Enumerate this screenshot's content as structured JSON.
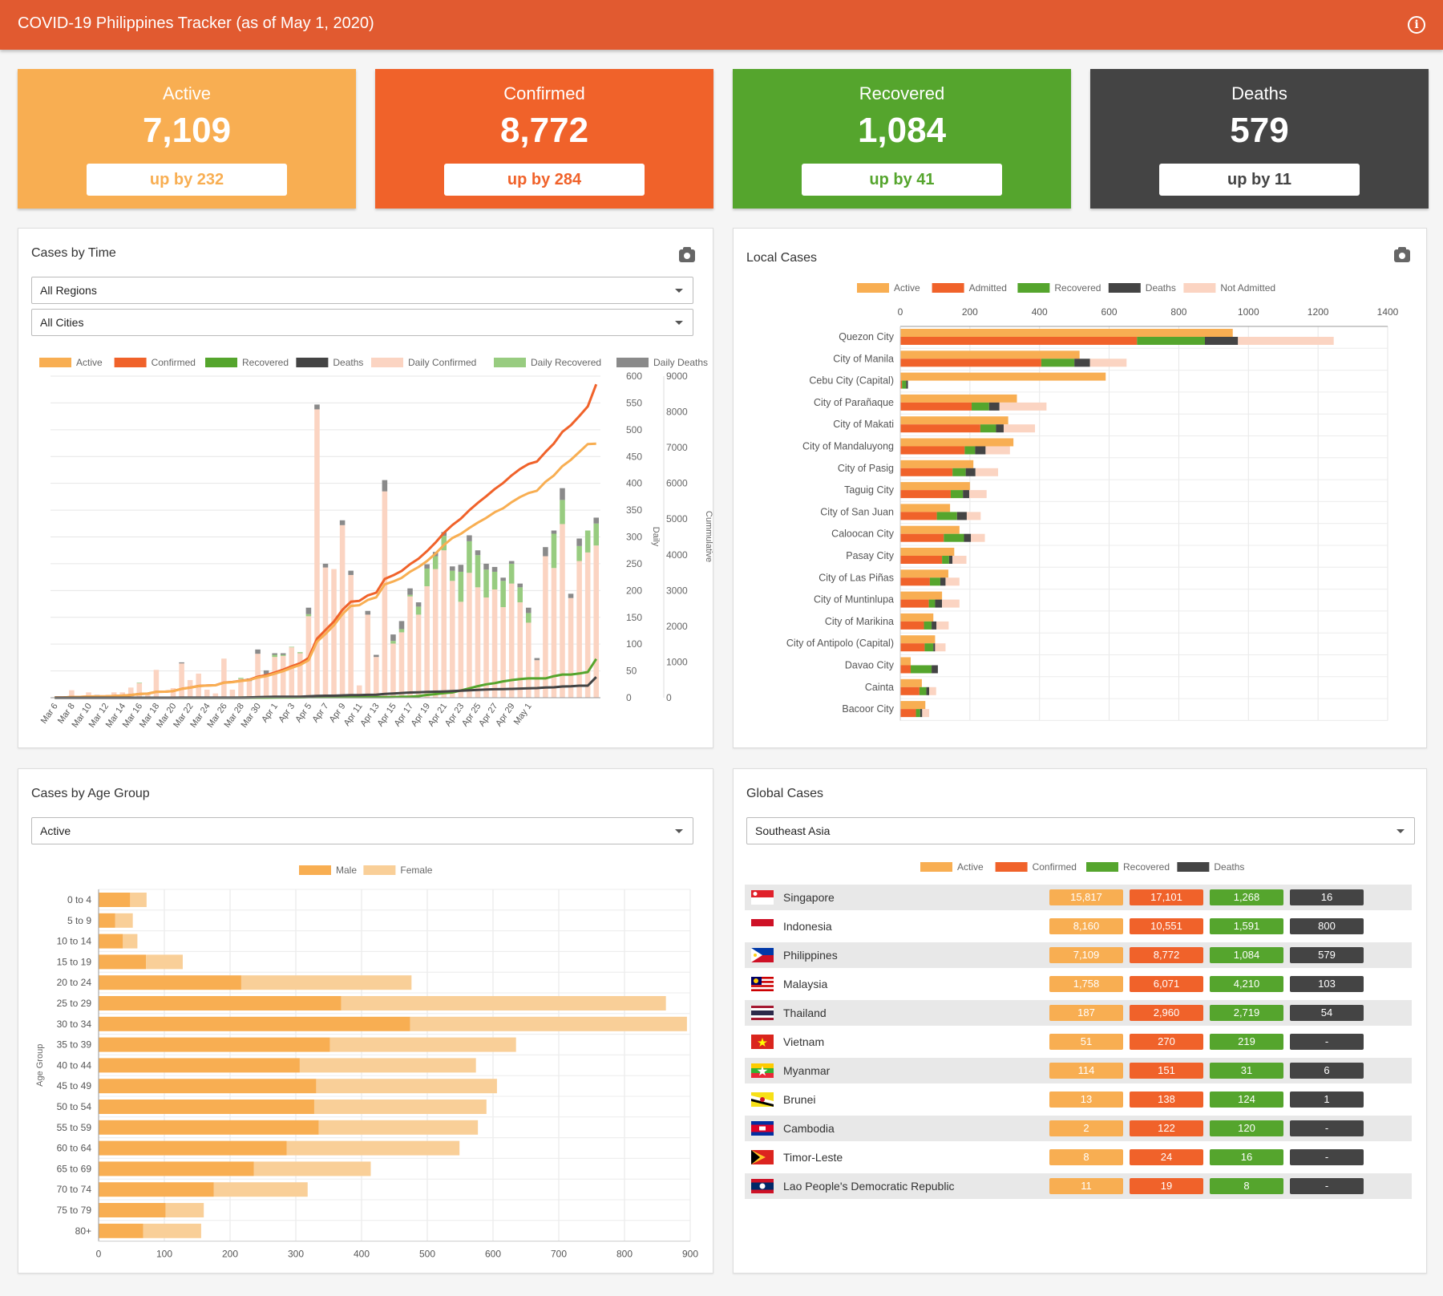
{
  "app": {
    "title": "COVID-19 Philippines Tracker (as of May 1, 2020)",
    "info_icon": "info-icon"
  },
  "colors": {
    "active": "#f8ae52",
    "confirmed": "#f0622a",
    "recovered": "#55a52d",
    "deaths": "#444444",
    "not_admitted": "#fbd4c2",
    "daily_recovered": "#98cc80",
    "daily_deaths": "#8a8a8a",
    "female": "#f9cf98"
  },
  "stats": [
    {
      "label": "Active",
      "value": "7,109",
      "change": "up by 232",
      "color": "#f8ae52"
    },
    {
      "label": "Confirmed",
      "value": "8,772",
      "change": "up by 284",
      "color": "#f0622a"
    },
    {
      "label": "Recovered",
      "value": "1,084",
      "change": "up by 41",
      "color": "#55a52d"
    },
    {
      "label": "Deaths",
      "value": "579",
      "change": "up by 11",
      "color": "#444444"
    }
  ],
  "time_card": {
    "title": "Cases by Time",
    "region_select": "All Regions",
    "city_select": "All Cities",
    "legend": [
      "Active",
      "Confirmed",
      "Recovered",
      "Deaths",
      "Daily Confirmed",
      "Daily Recovered",
      "Daily Deaths"
    ]
  },
  "local_card": {
    "title": "Local Cases",
    "legend": [
      "Active",
      "Admitted",
      "Recovered",
      "Deaths",
      "Not Admitted"
    ]
  },
  "age_card": {
    "title": "Cases by Age Group",
    "select": "Active",
    "legend": [
      "Male",
      "Female"
    ]
  },
  "global_card": {
    "title": "Global Cases",
    "select": "Southeast Asia",
    "legend": [
      "Active",
      "Confirmed",
      "Recovered",
      "Deaths"
    ],
    "rows": [
      {
        "country": "Singapore",
        "flag": "singapore",
        "active": "15,817",
        "confirmed": "17,101",
        "recovered": "1,268",
        "deaths": "16"
      },
      {
        "country": "Indonesia",
        "flag": "indonesia",
        "active": "8,160",
        "confirmed": "10,551",
        "recovered": "1,591",
        "deaths": "800"
      },
      {
        "country": "Philippines",
        "flag": "philippines",
        "active": "7,109",
        "confirmed": "8,772",
        "recovered": "1,084",
        "deaths": "579"
      },
      {
        "country": "Malaysia",
        "flag": "malaysia",
        "active": "1,758",
        "confirmed": "6,071",
        "recovered": "4,210",
        "deaths": "103"
      },
      {
        "country": "Thailand",
        "flag": "thailand",
        "active": "187",
        "confirmed": "2,960",
        "recovered": "2,719",
        "deaths": "54"
      },
      {
        "country": "Vietnam",
        "flag": "vietnam",
        "active": "51",
        "confirmed": "270",
        "recovered": "219",
        "deaths": "-"
      },
      {
        "country": "Myanmar",
        "flag": "myanmar",
        "active": "114",
        "confirmed": "151",
        "recovered": "31",
        "deaths": "6"
      },
      {
        "country": "Brunei",
        "flag": "brunei",
        "active": "13",
        "confirmed": "138",
        "recovered": "124",
        "deaths": "1"
      },
      {
        "country": "Cambodia",
        "flag": "cambodia",
        "active": "2",
        "confirmed": "122",
        "recovered": "120",
        "deaths": "-"
      },
      {
        "country": "Timor-Leste",
        "flag": "timor-leste",
        "active": "8",
        "confirmed": "24",
        "recovered": "16",
        "deaths": "-"
      },
      {
        "country": "Lao People's Democratic Republic",
        "flag": "laos",
        "active": "11",
        "confirmed": "19",
        "recovered": "8",
        "deaths": "-"
      }
    ]
  },
  "chart_data": [
    {
      "type": "bar",
      "chart": "cases-by-time",
      "y_daily_label": "Daily",
      "y_cum_label": "Cummulative",
      "y_daily_range": [
        0,
        600
      ],
      "y_cum_range": [
        0,
        9000
      ],
      "y_daily_ticks": [
        0,
        50,
        100,
        150,
        200,
        250,
        300,
        350,
        400,
        450,
        500,
        550,
        600
      ],
      "y_cum_ticks": [
        0,
        1000,
        2000,
        3000,
        4000,
        5000,
        6000,
        7000,
        8000,
        9000
      ],
      "x_tick_labels": [
        "Mar 6",
        "Mar 8",
        "Mar 10",
        "Mar 12",
        "Mar 14",
        "Mar 16",
        "Mar 18",
        "Mar 20",
        "Mar 22",
        "Mar 24",
        "Mar 26",
        "Mar 28",
        "Mar 30",
        "Apr 1",
        "Apr 3",
        "Apr 5",
        "Apr 7",
        "Apr 9",
        "Apr 11",
        "Apr 13",
        "Apr 15",
        "Apr 17",
        "Apr 19",
        "Apr 21",
        "Apr 23",
        "Apr 25",
        "Apr 27",
        "Apr 29",
        "May 1"
      ],
      "daily_confirmed": [
        1,
        1,
        14,
        3,
        10,
        4,
        1,
        10,
        10,
        19,
        27,
        10,
        52,
        2,
        18,
        64,
        33,
        45,
        15,
        8,
        73,
        15,
        35,
        31,
        82,
        44,
        76,
        78,
        94,
        83,
        152,
        538,
        243,
        240,
        322,
        229,
        23,
        155,
        76,
        385,
        101,
        122,
        189,
        155,
        208,
        240,
        275,
        218,
        179,
        233,
        206,
        187,
        202,
        169,
        213,
        178,
        140,
        70,
        264,
        242,
        324,
        186,
        255,
        271,
        284
      ],
      "daily_recovered": [
        0,
        0,
        0,
        0,
        0,
        0,
        0,
        0,
        0,
        0,
        1,
        0,
        0,
        0,
        0,
        0,
        0,
        0,
        0,
        0,
        0,
        0,
        2,
        0,
        0,
        0,
        4,
        2,
        1,
        2,
        4,
        0,
        0,
        0,
        0,
        0,
        0,
        0,
        0,
        0,
        5,
        6,
        3,
        15,
        33,
        24,
        27,
        19,
        56,
        59,
        60,
        52,
        33,
        49,
        37,
        28,
        18,
        0,
        0,
        64,
        45,
        0,
        28,
        41,
        41
      ],
      "daily_deaths": [
        0,
        0,
        0,
        0,
        0,
        1,
        0,
        0,
        0,
        0,
        0,
        0,
        0,
        0,
        0,
        2,
        0,
        0,
        0,
        0,
        0,
        0,
        0,
        5,
        8,
        7,
        3,
        3,
        0,
        0,
        12,
        9,
        7,
        0,
        9,
        8,
        0,
        7,
        4,
        21,
        12,
        15,
        12,
        8,
        8,
        8,
        7,
        8,
        13,
        11,
        9,
        11,
        9,
        6,
        5,
        7,
        10,
        4,
        17,
        6,
        22,
        8,
        14,
        0,
        11
      ],
      "cumulative_confirmed": [
        5,
        6,
        20,
        23,
        33,
        37,
        38,
        48,
        58,
        77,
        104,
        114,
        166,
        168,
        186,
        250,
        283,
        328,
        343,
        351,
        424,
        439,
        474,
        505,
        587,
        631,
        707,
        785,
        879,
        962,
        1114,
        1652,
        1895,
        2135,
        2457,
        2686,
        2709,
        2864,
        2940,
        3325,
        3426,
        3548,
        3737,
        3892,
        4100,
        4340,
        4615,
        4833,
        5012,
        5245,
        5451,
        5638,
        5840,
        6009,
        6222,
        6400,
        6540,
        6610,
        6874,
        7116,
        7440,
        7626,
        7881,
        8152,
        8772
      ],
      "cumulative_active": [
        5,
        6,
        20,
        23,
        33,
        36,
        38,
        48,
        58,
        77,
        103,
        114,
        166,
        168,
        186,
        247,
        280,
        325,
        340,
        348,
        420,
        435,
        468,
        494,
        566,
        603,
        672,
        745,
        838,
        916,
        1048,
        1566,
        1787,
        2030,
        2339,
        2567,
        2590,
        2737,
        2809,
        3172,
        3251,
        3353,
        3527,
        3659,
        3825,
        4033,
        4276,
        4469,
        4587,
        4750,
        4900,
        5031,
        5191,
        5301,
        5472,
        5615,
        5727,
        5793,
        6041,
        6222,
        6479,
        6657,
        6876,
        7098,
        7109
      ],
      "cumulative_recovered": [
        0,
        0,
        0,
        0,
        0,
        0,
        0,
        0,
        0,
        0,
        1,
        1,
        1,
        1,
        1,
        1,
        1,
        1,
        1,
        1,
        1,
        1,
        3,
        3,
        3,
        3,
        7,
        9,
        10,
        12,
        16,
        16,
        16,
        16,
        16,
        16,
        16,
        16,
        16,
        16,
        21,
        27,
        30,
        45,
        78,
        102,
        129,
        148,
        204,
        263,
        323,
        375,
        408,
        457,
        494,
        522,
        540,
        540,
        540,
        604,
        649,
        649,
        677,
        718,
        1084
      ],
      "cumulative_deaths": [
        0,
        0,
        0,
        0,
        0,
        1,
        1,
        1,
        1,
        1,
        1,
        1,
        1,
        1,
        1,
        3,
        3,
        3,
        3,
        3,
        3,
        3,
        3,
        8,
        16,
        23,
        26,
        29,
        29,
        29,
        41,
        50,
        57,
        57,
        66,
        74,
        74,
        81,
        85,
        106,
        118,
        133,
        145,
        153,
        161,
        169,
        176,
        184,
        197,
        208,
        217,
        228,
        237,
        243,
        248,
        255,
        265,
        269,
        286,
        292,
        314,
        322,
        336,
        336,
        579
      ]
    },
    {
      "type": "bar",
      "chart": "local-cases",
      "x_range": [
        0,
        1400
      ],
      "x_ticks": [
        0,
        200,
        400,
        600,
        800,
        1000,
        1200,
        1400
      ],
      "categories": [
        "Quezon City",
        "City of Manila",
        "Cebu City (Capital)",
        "City of Parañaque",
        "City of Makati",
        "City of Mandaluyong",
        "City of Pasig",
        "Taguig City",
        "City of San Juan",
        "Caloocan City",
        "Pasay City",
        "City of Las Piñas",
        "City of Muntinlupa",
        "City of Marikina",
        "City of Antipolo (Capital)",
        "Davao City",
        "Cainta",
        "Bacoor City"
      ],
      "active": [
        955,
        515,
        590,
        335,
        310,
        325,
        210,
        200,
        143,
        170,
        155,
        138,
        120,
        95,
        100,
        30,
        62,
        72
      ],
      "admitted": [
        680,
        405,
        5,
        205,
        230,
        185,
        150,
        145,
        105,
        125,
        120,
        85,
        82,
        68,
        70,
        30,
        55,
        45
      ],
      "recovered": [
        195,
        95,
        12,
        50,
        45,
        30,
        38,
        35,
        58,
        58,
        20,
        30,
        18,
        22,
        25,
        60,
        20,
        12
      ],
      "deaths": [
        95,
        45,
        5,
        30,
        22,
        30,
        28,
        18,
        28,
        20,
        10,
        15,
        20,
        14,
        5,
        18,
        8,
        6
      ],
      "not_admitted": [
        275,
        105,
        0,
        135,
        90,
        70,
        65,
        50,
        40,
        40,
        40,
        40,
        50,
        35,
        30,
        0,
        20,
        20
      ]
    },
    {
      "type": "bar",
      "chart": "cases-by-age-group",
      "ylabel": "Age Group",
      "x_range": [
        0,
        900
      ],
      "x_ticks": [
        0,
        100,
        200,
        300,
        400,
        500,
        600,
        700,
        800,
        900
      ],
      "categories": [
        "0 to 4",
        "5 to 9",
        "10 to 14",
        "15 to 19",
        "20 to 24",
        "25 to 29",
        "30 to 34",
        "35 to 39",
        "40 to 44",
        "45 to 49",
        "50 to 54",
        "55 to 59",
        "60 to 64",
        "65 to 69",
        "70 to 74",
        "75 to 79",
        "80+"
      ],
      "series": [
        {
          "name": "Male",
          "values": [
            48,
            25,
            37,
            72,
            217,
            369,
            474,
            352,
            306,
            331,
            328,
            335,
            286,
            236,
            175,
            102,
            68
          ]
        },
        {
          "name": "Female",
          "values": [
            25,
            27,
            22,
            56,
            259,
            494,
            421,
            283,
            268,
            275,
            262,
            242,
            263,
            178,
            143,
            58,
            88
          ]
        }
      ]
    }
  ]
}
